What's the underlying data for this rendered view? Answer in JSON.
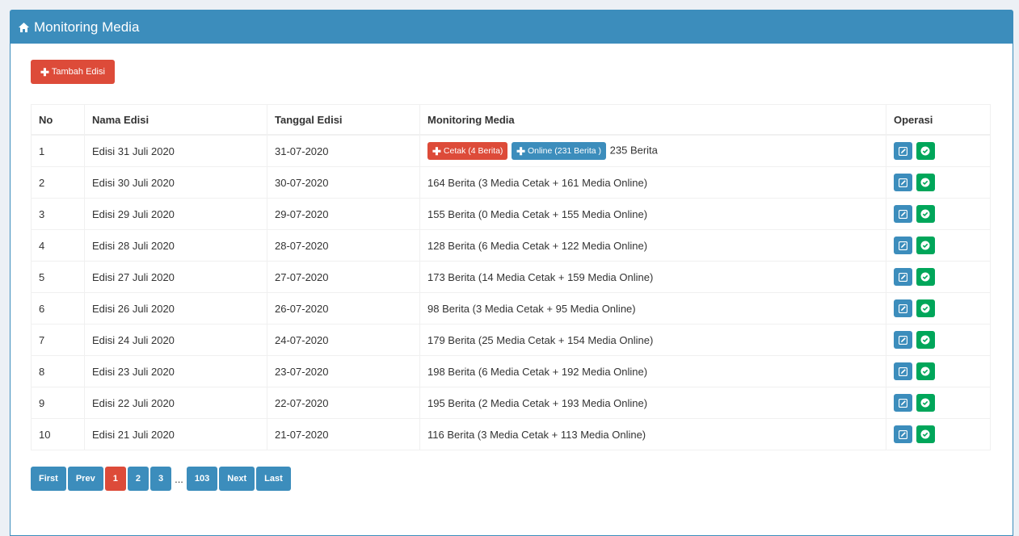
{
  "header": {
    "title": "Monitoring Media"
  },
  "add_button": {
    "label": "Tambah Edisi"
  },
  "table": {
    "headers": [
      "No",
      "Nama Edisi",
      "Tanggal Edisi",
      "Monitoring Media",
      "Operasi"
    ],
    "first_row_tags": {
      "cetak": "Cetak (4 Berita)",
      "online": "Online (231 Berita )",
      "total": "235 Berita"
    },
    "rows": [
      {
        "no": "1",
        "nama": "Edisi 31 Juli 2020",
        "tanggal": "31-07-2020",
        "monitoring": ""
      },
      {
        "no": "2",
        "nama": "Edisi 30 Juli 2020",
        "tanggal": "30-07-2020",
        "monitoring": "164 Berita (3 Media Cetak + 161 Media Online)"
      },
      {
        "no": "3",
        "nama": "Edisi 29 Juli 2020",
        "tanggal": "29-07-2020",
        "monitoring": "155 Berita (0 Media Cetak + 155 Media Online)"
      },
      {
        "no": "4",
        "nama": "Edisi 28 Juli 2020",
        "tanggal": "28-07-2020",
        "monitoring": "128 Berita (6 Media Cetak + 122 Media Online)"
      },
      {
        "no": "5",
        "nama": "Edisi 27 Juli 2020",
        "tanggal": "27-07-2020",
        "monitoring": "173 Berita (14 Media Cetak + 159 Media Online)"
      },
      {
        "no": "6",
        "nama": "Edisi 26 Juli 2020",
        "tanggal": "26-07-2020",
        "monitoring": "98 Berita (3 Media Cetak + 95 Media Online)"
      },
      {
        "no": "7",
        "nama": "Edisi 24 Juli 2020",
        "tanggal": "24-07-2020",
        "monitoring": "179 Berita (25 Media Cetak + 154 Media Online)"
      },
      {
        "no": "8",
        "nama": "Edisi 23 Juli 2020",
        "tanggal": "23-07-2020",
        "monitoring": "198 Berita (6 Media Cetak + 192 Media Online)"
      },
      {
        "no": "9",
        "nama": "Edisi 22 Juli 2020",
        "tanggal": "22-07-2020",
        "monitoring": "195 Berita (2 Media Cetak + 193 Media Online)"
      },
      {
        "no": "10",
        "nama": "Edisi 21 Juli 2020",
        "tanggal": "21-07-2020",
        "monitoring": "116 Berita (3 Media Cetak + 113 Media Online)"
      }
    ]
  },
  "pagination": {
    "first": "First",
    "prev": "Prev",
    "pages": [
      "1",
      "2",
      "3"
    ],
    "ellipsis": "...",
    "last_page": "103",
    "next": "Next",
    "last": "Last",
    "active_page": "1"
  },
  "colors": {
    "primary": "#3c8dbc",
    "danger": "#dd4b39",
    "success": "#00a65a"
  },
  "icons": {
    "header": "home-icon",
    "add": "plus-icon",
    "edit": "edit-icon",
    "approve": "check-circle-icon"
  }
}
